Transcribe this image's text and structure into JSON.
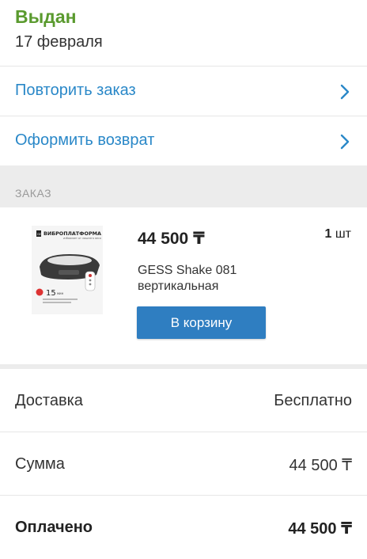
{
  "status": {
    "title": "Выдан",
    "date": "17 февраля"
  },
  "actions": [
    {
      "label": "Повторить заказ"
    },
    {
      "label": "Оформить возврат"
    }
  ],
  "section": {
    "title": "ЗАКАЗ"
  },
  "product": {
    "image_title": "ВИБРОПЛАТФОРМА",
    "image_subtitle": "избавляет от лишнего веса",
    "image_brand": "GESS",
    "image_badge": "15",
    "image_badge_unit": "мин",
    "price": "44 500 ₸",
    "qty_number": "1",
    "qty_unit": "шт",
    "name": "GESS Shake 081 вертикальная",
    "cart_button": "В корзину"
  },
  "summary": [
    {
      "label": "Доставка",
      "value": "Бесплатно"
    },
    {
      "label": "Сумма",
      "value": "44 500 ₸"
    },
    {
      "label": "Оплачено",
      "value": "44 500 ₸"
    }
  ],
  "colors": {
    "status": "#5a9a2e",
    "link": "#2a88c8",
    "button": "#2f7ec1",
    "band": "#ececec"
  }
}
